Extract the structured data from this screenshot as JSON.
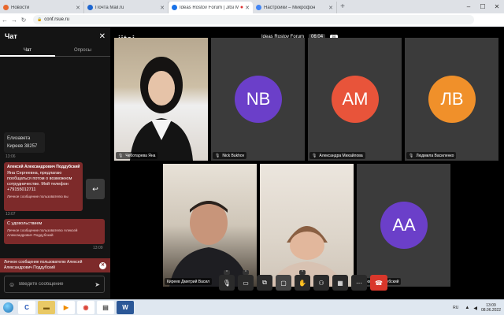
{
  "browser": {
    "tabs": [
      {
        "label": "Новости",
        "fav_color": "#e8672c"
      },
      {
        "label": "Почта Mail.ru",
        "fav_color": "#1e66d0"
      },
      {
        "label": "Ideas Rostov Forum | Jitsi Meet",
        "fav_color": "#1a73e8",
        "active": true
      },
      {
        "label": "Настройки – Микрофон",
        "fav_color": "#4285f4"
      }
    ],
    "url": "conf.rsue.ru"
  },
  "chat": {
    "title": "Чат",
    "tab_chat": "Чат",
    "tab_polls": "Опросы",
    "msg1_line1": "Елизавета",
    "msg1_line2": "Киреев 38257",
    "msg1_time": "13:06",
    "msg2_sender": "Алексей Александрович Поддубский",
    "msg2_body": "Яна Сергеевна, предлагаю пообщаться потом о возможном сотрудничестве. Мой телефон +79155012711",
    "msg2_note": "Личное сообщение пользователю вы",
    "msg2_time": "13:07",
    "msg3_body": "С удовольствием",
    "msg3_note": "Личное сообщение пользователю Алексей Александрович Поддубский",
    "msg3_time": "13:09",
    "banner": "Личное сообщение пользователю Алексей Александрович Поддубский",
    "input_placeholder": "Введите сообщение"
  },
  "stage": {
    "logo": "jitsi",
    "conference_title": "Ideas Rostov Forum",
    "timer": "06:04",
    "participants": [
      {
        "name": "Чеботарева Яна",
        "initials": "",
        "color": ""
      },
      {
        "name": "Nick Bukhov",
        "initials": "NB",
        "color": "#6b3fc9"
      },
      {
        "name": "Александра Михайлова",
        "initials": "АМ",
        "color": "#e8543a"
      },
      {
        "name": "Людмила Василенко",
        "initials": "ЛВ",
        "color": "#f0902a"
      },
      {
        "name": "Киреев Дмитрий Васил",
        "initials": "",
        "color": ""
      },
      {
        "name": "",
        "initials": "",
        "color": ""
      },
      {
        "name": "ндрович Поддубский",
        "initials": "АА",
        "color": "#6b3fc9"
      }
    ]
  },
  "taskbar": {
    "lang": "RU",
    "time": "13:09",
    "date": "08.06.2022"
  }
}
